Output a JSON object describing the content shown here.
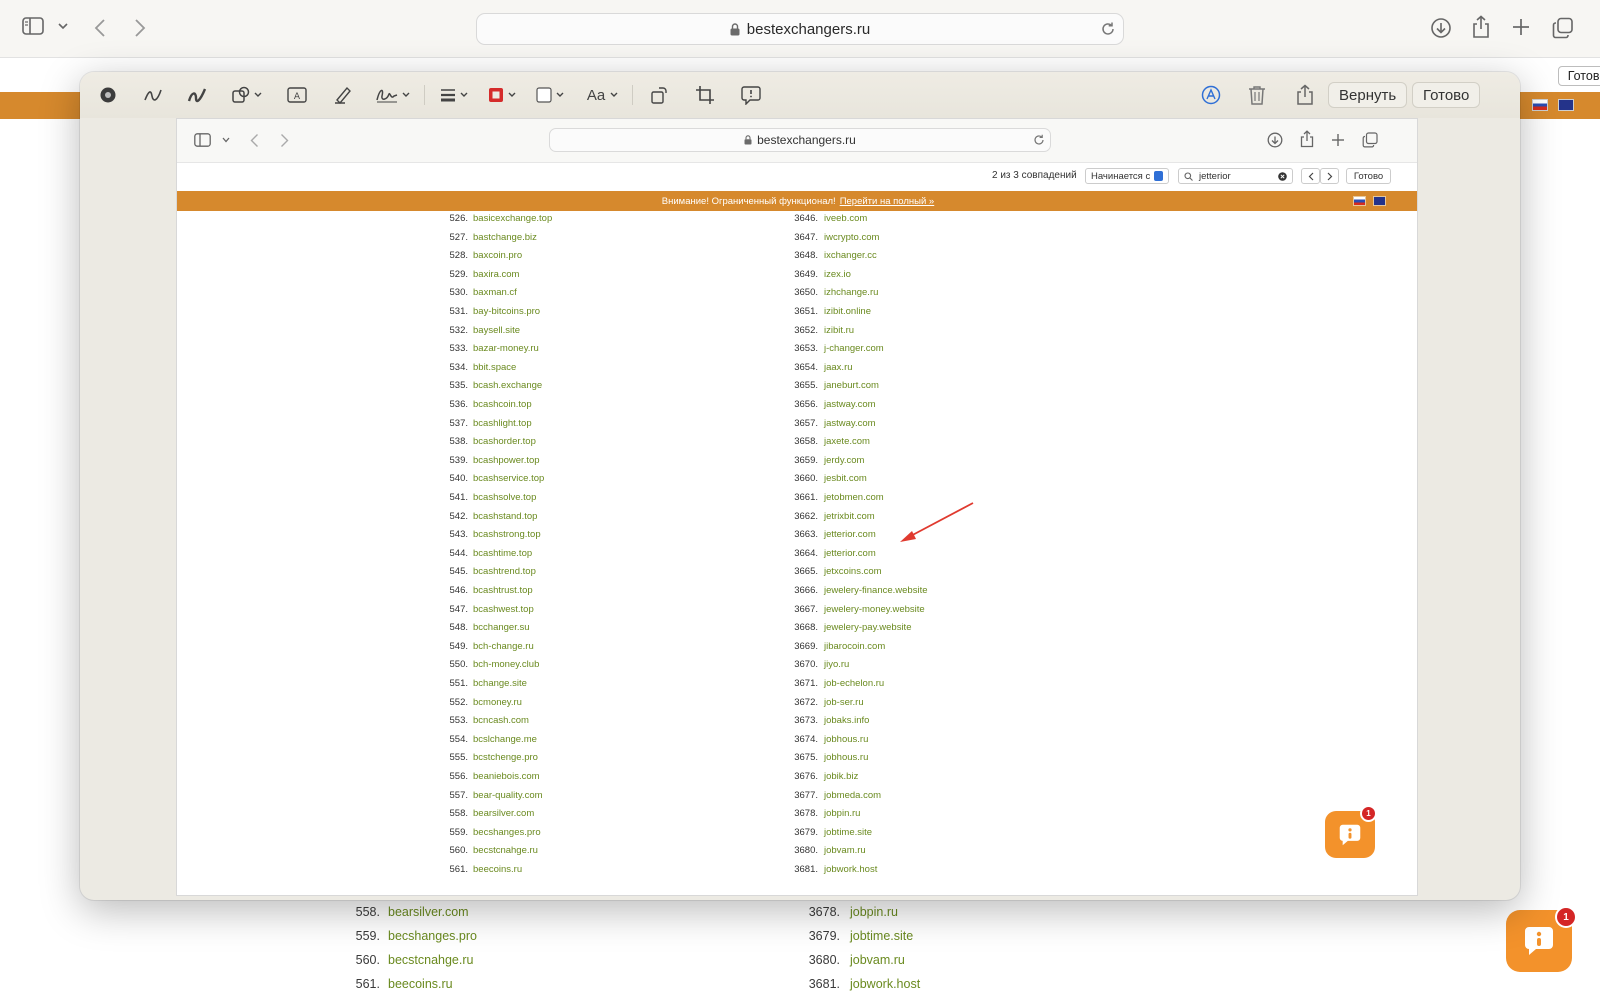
{
  "outer_toolbar": {
    "url": "bestexchangers.ru",
    "icons": [
      "sidebar-icon",
      "chevron-down-icon",
      "back-icon",
      "forward-icon",
      "lock-icon",
      "reload-icon",
      "download-icon",
      "share-icon",
      "new-tab-icon",
      "tabs-overview-icon"
    ]
  },
  "background_page": {
    "done_label": "Готово",
    "rows": [
      {
        "num": "558.",
        "site": "bearsilver.com",
        "num2": "3678.",
        "site2": "jobpin.ru"
      },
      {
        "num": "559.",
        "site": "becshanges.pro",
        "num2": "3679.",
        "site2": "jobtime.site"
      },
      {
        "num": "560.",
        "site": "becstcnahge.ru",
        "num2": "3680.",
        "site2": "jobvam.ru"
      },
      {
        "num": "561.",
        "site": "beecoins.ru",
        "num2": "3681.",
        "site2": "jobwork.host"
      }
    ],
    "chat_badge": "1",
    "banner_color": "#d6892d"
  },
  "markup_toolbar": {
    "revert_label": "Вернуть",
    "done_label": "Готово",
    "font_label": "Aa",
    "icons": [
      "record-icon",
      "sketch-icon",
      "draw-icon",
      "shapes-icon",
      "text-box-icon",
      "highlight-icon",
      "signature-icon",
      "line-style-icon",
      "border-color-icon",
      "fill-color-icon",
      "text-style-icon",
      "rotate-icon",
      "crop-icon",
      "description-icon",
      "autofill-icon",
      "trash-icon",
      "share-icon"
    ]
  },
  "inner_screenshot": {
    "url": "bestexchangers.ru",
    "find": {
      "match_text": "2 из 3 совпадений",
      "mode": "Начинается с",
      "query": "jetterior",
      "done_label": "Готово"
    },
    "banner": {
      "text": "Внимание! Ограниченный функционал!",
      "link": "Перейти на полный »"
    },
    "chat_badge": "1",
    "left_column": [
      {
        "num": "526.",
        "site": "basicexchange.top"
      },
      {
        "num": "527.",
        "site": "bastchange.biz"
      },
      {
        "num": "528.",
        "site": "baxcoin.pro"
      },
      {
        "num": "529.",
        "site": "baxira.com"
      },
      {
        "num": "530.",
        "site": "baxman.cf"
      },
      {
        "num": "531.",
        "site": "bay-bitcoins.pro"
      },
      {
        "num": "532.",
        "site": "baysell.site"
      },
      {
        "num": "533.",
        "site": "bazar-money.ru"
      },
      {
        "num": "534.",
        "site": "bbit.space"
      },
      {
        "num": "535.",
        "site": "bcash.exchange"
      },
      {
        "num": "536.",
        "site": "bcashcoin.top"
      },
      {
        "num": "537.",
        "site": "bcashlight.top"
      },
      {
        "num": "538.",
        "site": "bcashorder.top"
      },
      {
        "num": "539.",
        "site": "bcashpower.top"
      },
      {
        "num": "540.",
        "site": "bcashservice.top"
      },
      {
        "num": "541.",
        "site": "bcashsolve.top"
      },
      {
        "num": "542.",
        "site": "bcashstand.top"
      },
      {
        "num": "543.",
        "site": "bcashstrong.top"
      },
      {
        "num": "544.",
        "site": "bcashtime.top"
      },
      {
        "num": "545.",
        "site": "bcashtrend.top"
      },
      {
        "num": "546.",
        "site": "bcashtrust.top"
      },
      {
        "num": "547.",
        "site": "bcashwest.top"
      },
      {
        "num": "548.",
        "site": "bcchanger.su"
      },
      {
        "num": "549.",
        "site": "bch-change.ru"
      },
      {
        "num": "550.",
        "site": "bch-money.club"
      },
      {
        "num": "551.",
        "site": "bchange.site"
      },
      {
        "num": "552.",
        "site": "bcmoney.ru"
      },
      {
        "num": "553.",
        "site": "bcncash.com"
      },
      {
        "num": "554.",
        "site": "bcslchange.me"
      },
      {
        "num": "555.",
        "site": "bcstchenge.pro"
      },
      {
        "num": "556.",
        "site": "beaniebois.com"
      },
      {
        "num": "557.",
        "site": "bear-quality.com"
      },
      {
        "num": "558.",
        "site": "bearsilver.com"
      },
      {
        "num": "559.",
        "site": "becshanges.pro"
      },
      {
        "num": "560.",
        "site": "becstcnahge.ru"
      },
      {
        "num": "561.",
        "site": "beecoins.ru"
      }
    ],
    "right_column": [
      {
        "num": "3646.",
        "site": "iveeb.com"
      },
      {
        "num": "3647.",
        "site": "iwcrypto.com"
      },
      {
        "num": "3648.",
        "site": "ixchanger.cc"
      },
      {
        "num": "3649.",
        "site": "izex.io"
      },
      {
        "num": "3650.",
        "site": "izhchange.ru"
      },
      {
        "num": "3651.",
        "site": "izibit.online"
      },
      {
        "num": "3652.",
        "site": "izibit.ru"
      },
      {
        "num": "3653.",
        "site": "j-changer.com"
      },
      {
        "num": "3654.",
        "site": "jaax.ru"
      },
      {
        "num": "3655.",
        "site": "janeburt.com"
      },
      {
        "num": "3656.",
        "site": "jastway.com"
      },
      {
        "num": "3657.",
        "site": "jastway.com"
      },
      {
        "num": "3658.",
        "site": "jaxete.com"
      },
      {
        "num": "3659.",
        "site": "jerdy.com"
      },
      {
        "num": "3660.",
        "site": "jesbit.com"
      },
      {
        "num": "3661.",
        "site": "jetobmen.com"
      },
      {
        "num": "3662.",
        "site": "jetrixbit.com"
      },
      {
        "num": "3663.",
        "site": "jetterior.com"
      },
      {
        "num": "3664.",
        "site": "jetterior.com"
      },
      {
        "num": "3665.",
        "site": "jetxcoins.com"
      },
      {
        "num": "3666.",
        "site": "jewelery-finance.website"
      },
      {
        "num": "3667.",
        "site": "jewelery-money.website"
      },
      {
        "num": "3668.",
        "site": "jewelery-pay.website"
      },
      {
        "num": "3669.",
        "site": "jibarocoin.com"
      },
      {
        "num": "3670.",
        "site": "jiyo.ru"
      },
      {
        "num": "3671.",
        "site": "job-echelon.ru"
      },
      {
        "num": "3672.",
        "site": "job-ser.ru"
      },
      {
        "num": "3673.",
        "site": "jobaks.info"
      },
      {
        "num": "3674.",
        "site": "jobhous.ru"
      },
      {
        "num": "3675.",
        "site": "jobhous.ru"
      },
      {
        "num": "3676.",
        "site": "jobik.biz"
      },
      {
        "num": "3677.",
        "site": "jobmeda.com"
      },
      {
        "num": "3678.",
        "site": "jobpin.ru"
      },
      {
        "num": "3679.",
        "site": "jobtime.site"
      },
      {
        "num": "3680.",
        "site": "jobvam.ru"
      },
      {
        "num": "3681.",
        "site": "jobwork.host"
      }
    ],
    "annotation_arrow_color": "#e03a2f",
    "link_color": "#6a8a1f"
  }
}
